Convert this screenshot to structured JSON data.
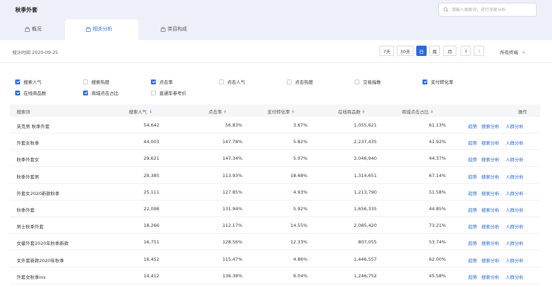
{
  "header": {
    "title": "秋季外套",
    "search_placeholder": "请输入搜索词，进行深度分析"
  },
  "tabs": [
    {
      "label": "概况",
      "active": false
    },
    {
      "label": "相关分析",
      "active": true
    },
    {
      "label": "类目构成",
      "active": false
    }
  ],
  "stats": {
    "time_label": "统计时间 2020-09-25",
    "date_buttons": [
      {
        "label": "7天",
        "active": false
      },
      {
        "label": "30天",
        "active": false
      },
      {
        "label": "日",
        "active": true
      },
      {
        "label": "周",
        "active": false
      },
      {
        "label": "月",
        "active": false
      }
    ],
    "prev_icon": "chevron-left-icon",
    "next_icon": "chevron-right-icon",
    "terminal_label": "所有终端"
  },
  "metrics": [
    {
      "label": "搜索人气",
      "checked": true
    },
    {
      "label": "搜索热度",
      "checked": false
    },
    {
      "label": "点击率",
      "checked": true
    },
    {
      "label": "点击人气",
      "checked": false
    },
    {
      "label": "点击热度",
      "checked": false
    },
    {
      "label": "交易指数",
      "checked": false
    },
    {
      "label": "支付转化率",
      "checked": true
    },
    {
      "label": "在线商品数",
      "checked": true
    },
    {
      "label": "商城点击占比",
      "checked": true
    },
    {
      "label": "直通车参考价",
      "checked": false
    }
  ],
  "table": {
    "columns": [
      "搜索词",
      "搜索人气",
      "点击率",
      "支付转化率",
      "在线商品数",
      "商城点击占比",
      "操作"
    ],
    "actions": [
      "趋势",
      "搜索分析",
      "人群分析"
    ],
    "rows": [
      {
        "term": "夹克男 秋季外套",
        "popularity": "54,642",
        "ctr": "56.83%",
        "cvr": "3.67%",
        "items": "1,055,621",
        "mall": "61.13%"
      },
      {
        "term": "外套女秋季",
        "popularity": "44,003",
        "ctr": "147.78%",
        "cvr": "5.82%",
        "items": "2,237,435",
        "mall": "41.92%"
      },
      {
        "term": "秋季外套女",
        "popularity": "29,621",
        "ctr": "147.34%",
        "cvr": "5.07%",
        "items": "2,046,940",
        "mall": "44.37%"
      },
      {
        "term": "秋季外套男",
        "popularity": "29,385",
        "ctr": "113.93%",
        "cvr": "18.68%",
        "items": "1,314,651",
        "mall": "67.14%"
      },
      {
        "term": "外套女2020新款秋季",
        "popularity": "25,111",
        "ctr": "127.85%",
        "cvr": "4.93%",
        "items": "1,213,790",
        "mall": "51.58%"
      },
      {
        "term": "秋季外套",
        "popularity": "22,098",
        "ctr": "131.94%",
        "cvr": "5.92%",
        "items": "1,656,335",
        "mall": "44.85%"
      },
      {
        "term": "男士秋季外套",
        "popularity": "18,266",
        "ctr": "112.17%",
        "cvr": "14.55%",
        "items": "2,085,420",
        "mall": "73.21%"
      },
      {
        "term": "女量外套2020年秋季新款",
        "popularity": "16,751",
        "ctr": "128.56%",
        "cvr": "12.33%",
        "items": "807,055",
        "mall": "53.74%"
      },
      {
        "term": "女外套新款2020年秋季",
        "popularity": "16,452",
        "ctr": "115.47%",
        "cvr": "4.86%",
        "items": "1,446,557",
        "mall": "62.00%"
      },
      {
        "term": "外套女秋季ins",
        "popularity": "14,412",
        "ctr": "136.38%",
        "cvr": "6.04%",
        "items": "1,246,752",
        "mall": "45.58%"
      }
    ]
  },
  "colors": {
    "accent": "#2d6ad9",
    "header_bg": "#edf0f8"
  }
}
